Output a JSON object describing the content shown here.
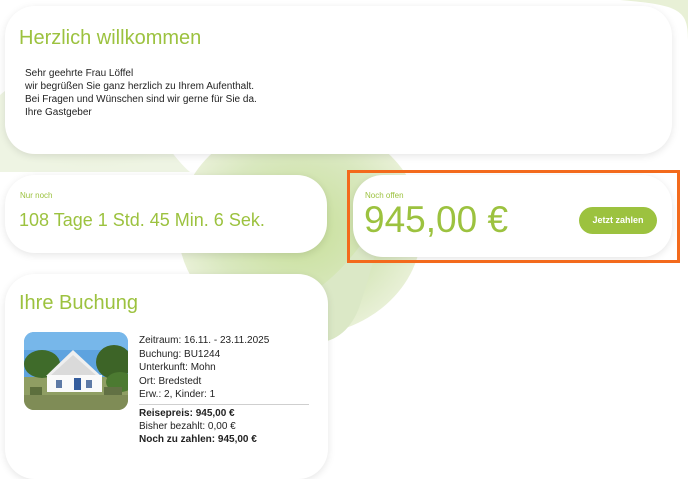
{
  "welcome": {
    "title": "Herzlich willkommen",
    "greeting": "Sehr geehrte Frau Löffel",
    "line1": "wir begrüßen Sie ganz herzlich zu Ihrem Aufenthalt.",
    "line2": "Bei Fragen und Wünschen sind wir gerne für Sie da.",
    "signoff": "Ihre Gastgeber"
  },
  "countdown": {
    "label": "Nur noch",
    "value": "108 Tage 1 Std. 45 Min. 6 Sek."
  },
  "open_amount": {
    "label": "Noch offen",
    "amount": "945,00 €",
    "pay_button_label": "Jetzt zahlen"
  },
  "booking": {
    "title": "Ihre Buchung",
    "period": "Zeitraum: 16.11. - 23.11.2025",
    "booking_number": "Buchung: BU1244",
    "accommodation": "Unterkunft: Mohn",
    "location": "Ort: Bredstedt",
    "guests": "Erw.: 2, Kinder: 1",
    "travel_price": "Reisepreis: 945,00 €",
    "paid": "Bisher bezahlt: 0,00 €",
    "to_pay": "Noch zu zahlen: 945,00 €"
  },
  "colors": {
    "accent": "#9cc23f",
    "highlight_frame": "#f36a1c",
    "background_shape": "#d9e8bf"
  }
}
